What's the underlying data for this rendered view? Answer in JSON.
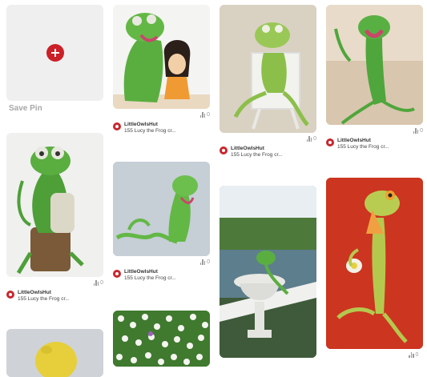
{
  "save_tile": {
    "label": "Save Pin",
    "icon": "plus-icon"
  },
  "pins": [
    {
      "owner": "LittleOwlsHut",
      "desc": "155 Lucy the Frog cr...",
      "count": "0",
      "image": "Crocheted green frog hugging a doll"
    },
    {
      "owner": "LittleOwlsHut",
      "desc": "155 Lucy the Frog cr...",
      "count": "0",
      "image": "Green frog sitting in white chair"
    },
    {
      "owner": "LittleOwlsHut",
      "desc": "155 Lucy the Frog cr...",
      "count": "0",
      "image": "Frog reclining on beige sofa"
    },
    {
      "owner": "LittleOwlsHut",
      "desc": "155 Lucy the Frog cr...",
      "count": "0",
      "image": "Frog holding a doll on a stump"
    },
    {
      "owner": "LittleOwlsHut",
      "desc": "155 Lucy the Frog cr...",
      "count": "0",
      "image": "Frog lying on the floor"
    },
    {
      "owner": "",
      "desc": "",
      "count": "",
      "image": "Frog on garden urn by a pond"
    },
    {
      "owner": "",
      "desc": "",
      "count": "0",
      "image": "Frog with teacup on red background"
    },
    {
      "owner": "",
      "desc": "",
      "count": "",
      "image": "Yellow crochet toy"
    },
    {
      "owner": "",
      "desc": "",
      "count": "",
      "image": "Field of white daisies"
    }
  ],
  "colors": {
    "brand_red": "#cb2027",
    "frog_green": "#4fa63c"
  }
}
